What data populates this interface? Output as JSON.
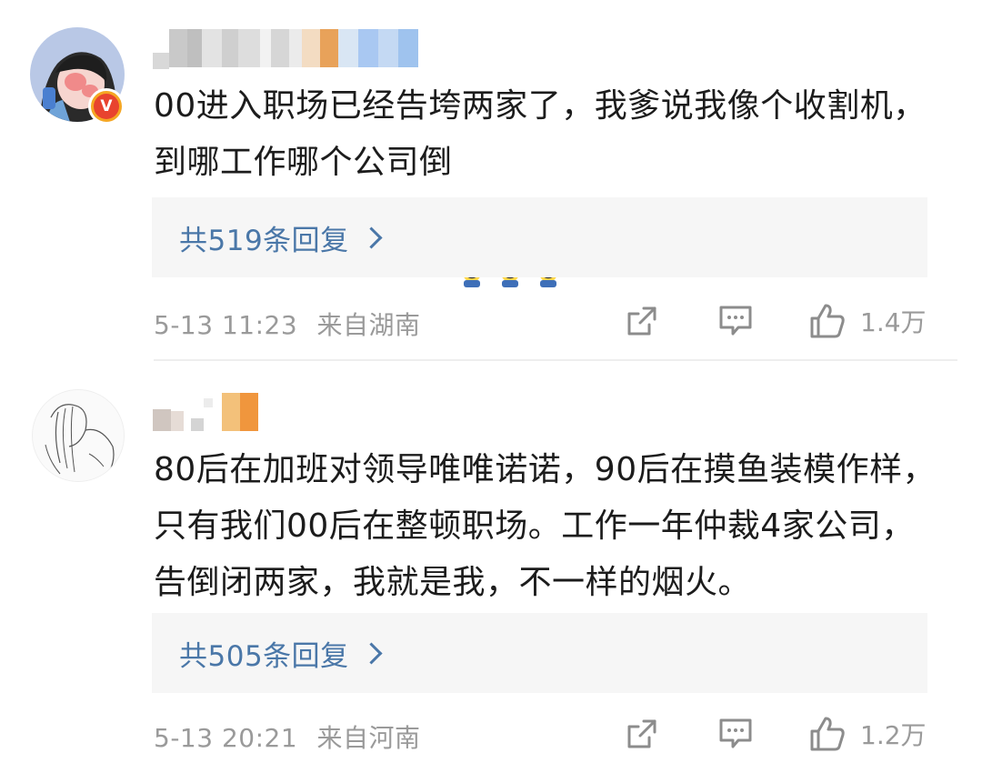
{
  "comments": [
    {
      "text": "00进入职场已经告垮两家了，我爹说我像个收割机，到哪工作哪个公司倒",
      "replies_label": "共519条回复",
      "timestamp": "5-13 11:23",
      "location": "来自湖南",
      "likes": "1.4万",
      "verified_badge": "V",
      "emoji_count": 3
    },
    {
      "text": "80后在加班对领导唯唯诺诺，90后在摸鱼装模作样，只有我们00后在整顿职场。工作一年仲裁4家公司，告倒闭两家，我就是我，不一样的烟火。",
      "replies_label": "共505条回复",
      "timestamp": "5-13 20:21",
      "location": "来自河南",
      "likes": "1.2万"
    }
  ],
  "icons": {
    "share": "share-icon",
    "comment": "comment-icon",
    "like": "thumbs-up-icon",
    "chevron": "chevron-right-icon",
    "emoji": "sweat-smile-emoji-icon"
  },
  "colors": {
    "link": "#4a77a8",
    "meta": "#9a9a9a",
    "text": "#1c1c1c",
    "reply_bg": "#f6f6f6",
    "badge": "#e8432f"
  }
}
